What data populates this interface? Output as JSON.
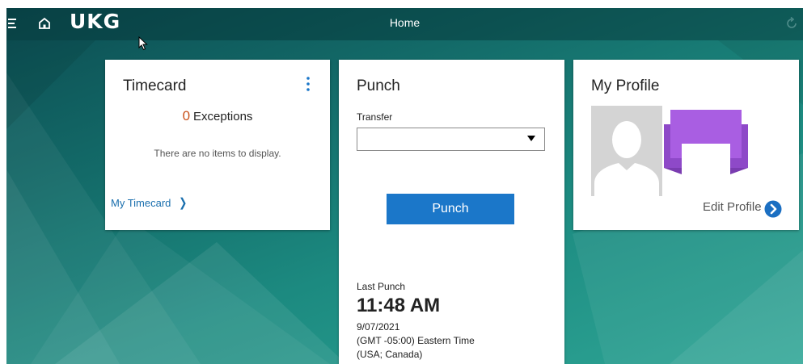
{
  "header": {
    "logo_text": "UKG",
    "page_title": "Home"
  },
  "timecard": {
    "title": "Timecard",
    "exceptions_count": "0",
    "exceptions_label": "Exceptions",
    "empty_text": "There are no items to display.",
    "link_label": "My Timecard",
    "link_chevron": "❯"
  },
  "punch": {
    "title": "Punch",
    "transfer_label": "Transfer",
    "transfer_value": "",
    "button_label": "Punch",
    "last_punch_label": "Last Punch",
    "last_punch_time": "11:48 AM",
    "last_punch_date": "9/07/2021",
    "last_punch_timezone": "(GMT -05:00) Eastern Time",
    "last_punch_region": "(USA; Canada)"
  },
  "profile": {
    "title": "My Profile",
    "edit_label": "Edit Profile"
  },
  "colors": {
    "accent_blue": "#1b77c9",
    "exception_orange": "#c8511a",
    "profile_ribbon": "#a95ee2"
  },
  "icons": [
    "menu-icon",
    "home-icon",
    "refresh-icon",
    "kebab-menu-icon",
    "chevron-right-icon",
    "caret-down-icon",
    "avatar-placeholder-icon",
    "chevron-circle-right-icon"
  ]
}
